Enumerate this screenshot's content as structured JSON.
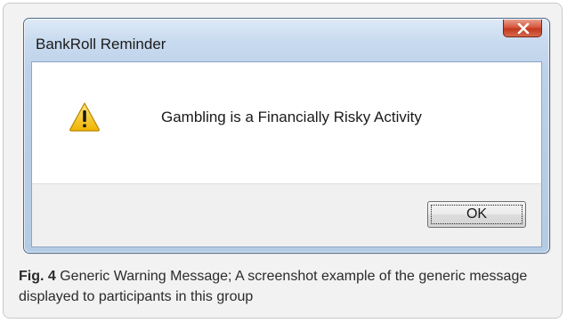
{
  "dialog": {
    "title": "BankRoll Reminder",
    "close_icon": "close-x-icon",
    "message_icon": "warning-triangle-icon",
    "message": "Gambling is a Financially Risky Activity",
    "ok_label": "OK"
  },
  "caption": {
    "label": "Fig. 4",
    "text": " Generic Warning Message; A screenshot example of the generic message displayed to participants in this group"
  },
  "colors": {
    "close_button": "#c2391e",
    "warning_fill": "#f5c400",
    "frame_border": "#4b6a8c"
  }
}
